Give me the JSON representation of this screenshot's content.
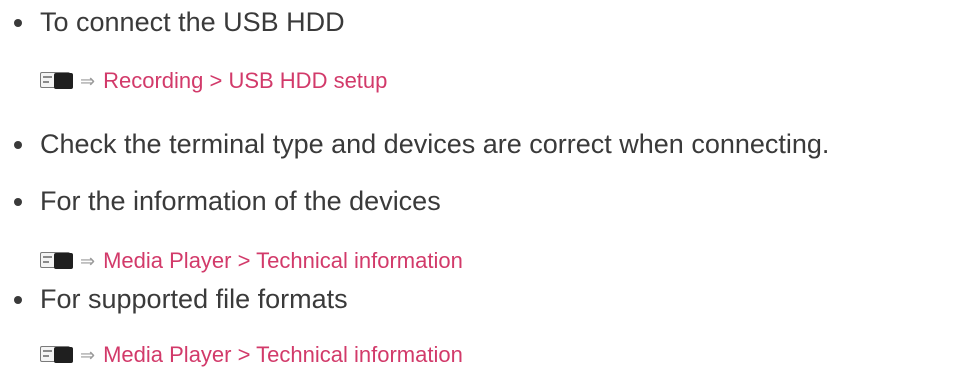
{
  "items": [
    {
      "text": "To connect the USB HDD",
      "link": {
        "icon": "menu-icon",
        "arrow": "⇒",
        "text": "Recording > USB HDD setup"
      }
    },
    {
      "text": "Check the terminal type and devices are correct when connecting."
    },
    {
      "text": "For the information of the devices",
      "link": {
        "icon": "menu-icon",
        "arrow": "⇒",
        "text": "Media Player > Technical information"
      }
    },
    {
      "text": "For supported file formats",
      "link": {
        "icon": "menu-icon",
        "arrow": "⇒",
        "text": "Media Player > Technical information"
      }
    }
  ],
  "colors": {
    "text": "#3a3a3a",
    "link": "#d23a6a",
    "arrow": "#9a9a9a"
  }
}
